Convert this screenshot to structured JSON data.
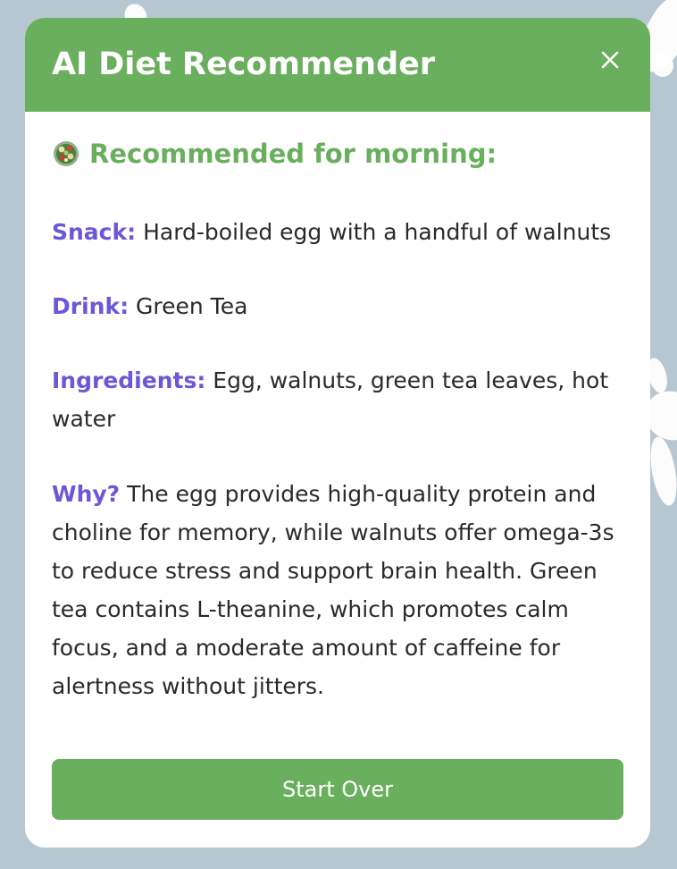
{
  "modal": {
    "title": "AI Diet Recommender",
    "subheading": "Recommended for morning:",
    "snack": {
      "label": "Snack:",
      "value": "Hard-boiled egg with a handful of walnuts"
    },
    "drink": {
      "label": "Drink:",
      "value": "Green Tea"
    },
    "ingredients": {
      "label": "Ingredients:",
      "value": "Egg, walnuts, green tea leaves, hot water"
    },
    "why": {
      "label": "Why?",
      "value": "The egg provides high-quality protein and choline for memory, while walnuts offer omega-3s to reduce stress and support brain health. Green tea contains L-theanine, which promotes calm focus, and a moderate amount of caffeine for alertness without jitters."
    },
    "start_over_label": "Start Over"
  },
  "icons": {
    "close": "close-icon",
    "salad": "salad-bowl-icon"
  },
  "colors": {
    "accent_green": "#6aaf5d",
    "label_purple": "#6a58d8",
    "background": "#b7c7d1"
  }
}
